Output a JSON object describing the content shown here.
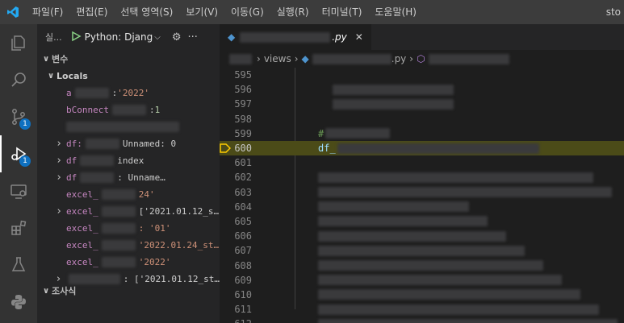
{
  "menu": {
    "items": [
      "파일(F)",
      "편집(E)",
      "선택 영역(S)",
      "보기(V)",
      "이동(G)",
      "실행(R)",
      "터미널(T)",
      "도움말(H)"
    ],
    "window_title": "sto"
  },
  "activity_bar": {
    "icons": [
      "explorer-icon",
      "search-icon",
      "source-control-icon",
      "run-debug-icon",
      "remote-explorer-icon",
      "extensions-icon",
      "testing-icon",
      "python-icon"
    ],
    "source_control_badge": "1",
    "debug_badge": "1"
  },
  "sidebar": {
    "run_label": "실...",
    "config_name": "Python: Djang",
    "variables_header": "변수",
    "locals_header": "Locals",
    "variables": [
      {
        "name": "a",
        "sep": ": ",
        "value": "'2022'",
        "kind": "str",
        "expandable": false
      },
      {
        "name": "bConnect",
        "sep": ": ",
        "value": "1",
        "kind": "num",
        "expandable": false
      },
      {
        "name": "",
        "sep": "",
        "value": "",
        "kind": "plain",
        "expandable": false
      },
      {
        "name": "df:",
        "sep": " ",
        "value": "Unnamed: 0",
        "kind": "plain",
        "expandable": true
      },
      {
        "name": "df",
        "sep": " ",
        "value": "index",
        "kind": "plain",
        "expandable": true
      },
      {
        "name": "df",
        "sep": " ",
        "value": ": Unname…",
        "kind": "plain",
        "expandable": true
      },
      {
        "name": "excel_",
        "sep": " ",
        "value": "24'",
        "kind": "str",
        "expandable": false
      },
      {
        "name": "excel_",
        "sep": " ",
        "value": "['2021.01.12_s…",
        "kind": "plain",
        "expandable": true
      },
      {
        "name": "excel_",
        "sep": " ",
        "value": ": '01'",
        "kind": "str",
        "expandable": false
      },
      {
        "name": "excel_",
        "sep": " ",
        "value": "'2022.01.24_st…",
        "kind": "str",
        "expandable": false
      },
      {
        "name": "excel_",
        "sep": " ",
        "value": "'2022'",
        "kind": "str",
        "expandable": false
      },
      {
        "name": "",
        "sep": " ",
        "value": ": ['2021.01.12_st…",
        "kind": "plain",
        "expandable": true
      }
    ],
    "watch_header": "조사식"
  },
  "editor": {
    "tab_label": ".py",
    "breadcrumb_folder": "views",
    "breadcrumb_file": ".py",
    "lines": [
      {
        "number": "595",
        "text": ""
      },
      {
        "number": "596",
        "text": ""
      },
      {
        "number": "597",
        "text": ""
      },
      {
        "number": "598",
        "text": ""
      },
      {
        "number": "599",
        "text": "#"
      },
      {
        "number": "600",
        "text": "df_"
      },
      {
        "number": "601",
        "text": ""
      },
      {
        "number": "602",
        "text": ""
      },
      {
        "number": "603",
        "text": ""
      },
      {
        "number": "604",
        "text": ""
      },
      {
        "number": "605",
        "text": ""
      },
      {
        "number": "606",
        "text": ""
      },
      {
        "number": "607",
        "text": ""
      },
      {
        "number": "608",
        "text": ""
      },
      {
        "number": "609",
        "text": ""
      },
      {
        "number": "610",
        "text": ""
      },
      {
        "number": "611",
        "text": ""
      },
      {
        "number": "612",
        "text": ""
      }
    ],
    "current_line": "600"
  },
  "colors": {
    "accent": "#0e70c0",
    "current_line_bg": "#4b4b18",
    "breakpoint_arrow": "#ffcc00"
  }
}
